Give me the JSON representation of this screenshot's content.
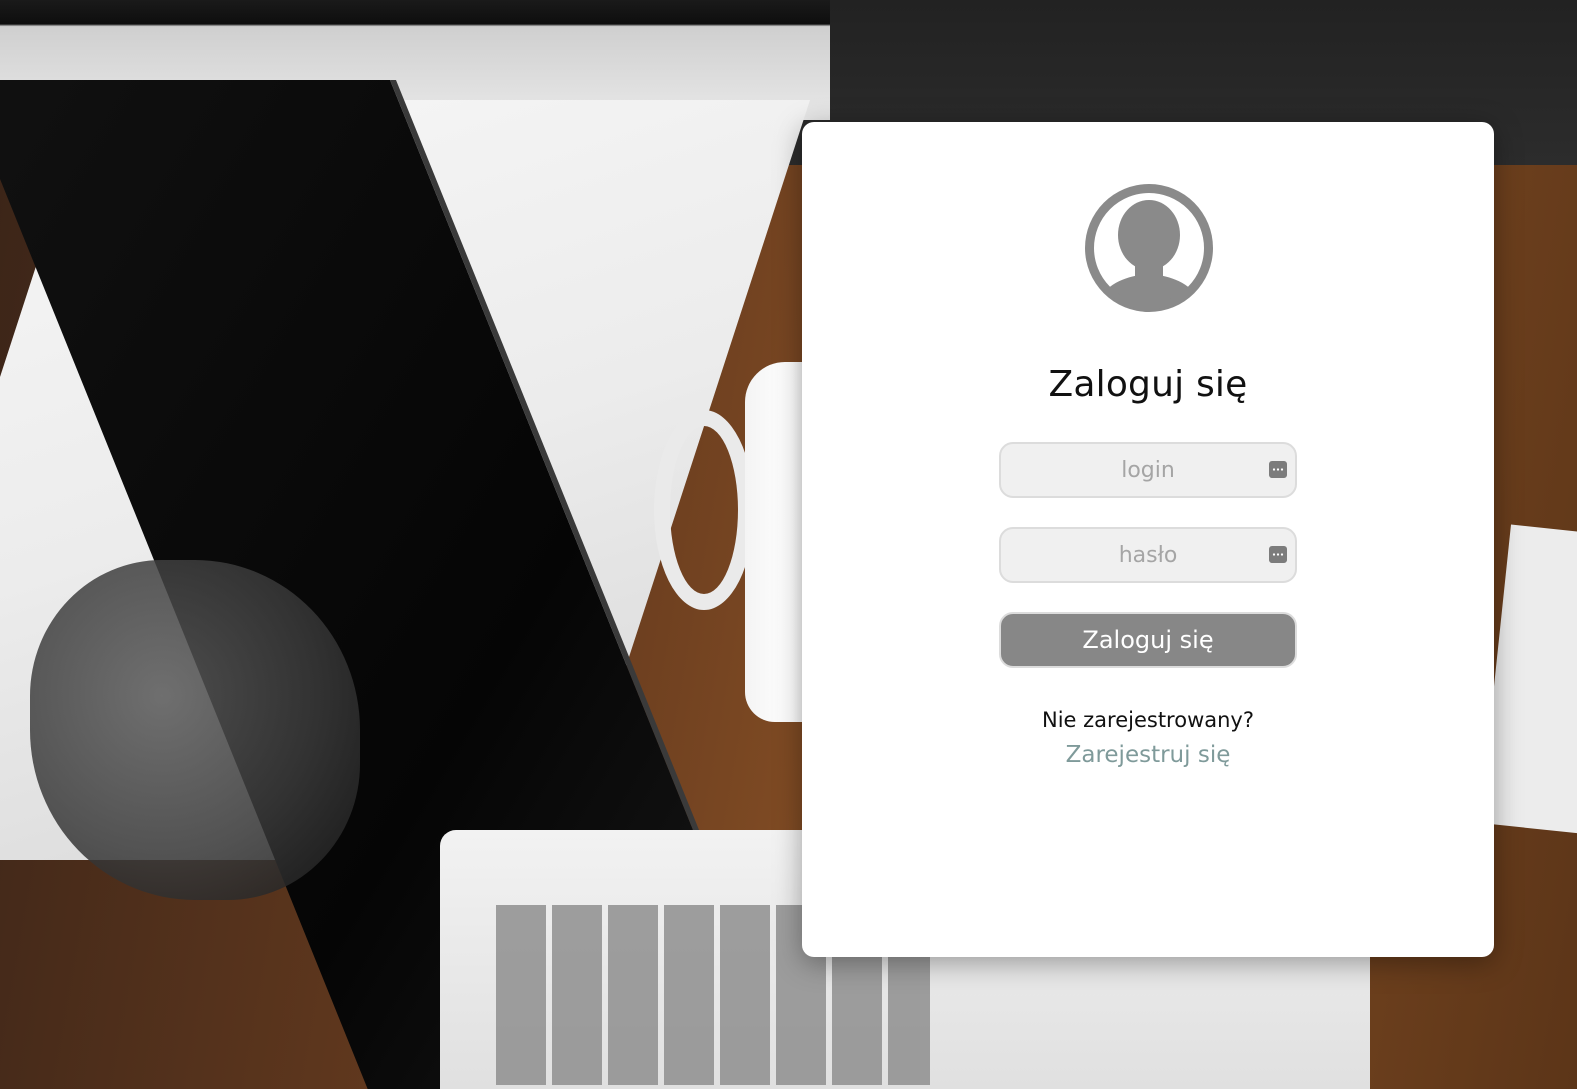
{
  "login_card": {
    "title": "Zaloguj się",
    "login_field": {
      "placeholder": "login",
      "value": ""
    },
    "password_field": {
      "placeholder": "hasło",
      "value": ""
    },
    "submit_label": "Zaloguj się",
    "not_registered_text": "Nie zarejestrowany?",
    "register_link_label": "Zarejestruj się"
  },
  "icons": {
    "avatar": "user-avatar-icon",
    "field_helper": "keyboard-icon"
  },
  "colors": {
    "card_background": "#ffffff",
    "avatar_gray": "#8a8a8a",
    "button_background": "#878787",
    "button_text": "#ffffff",
    "input_background": "#f0f0f0",
    "link": "#7f9a9a"
  }
}
